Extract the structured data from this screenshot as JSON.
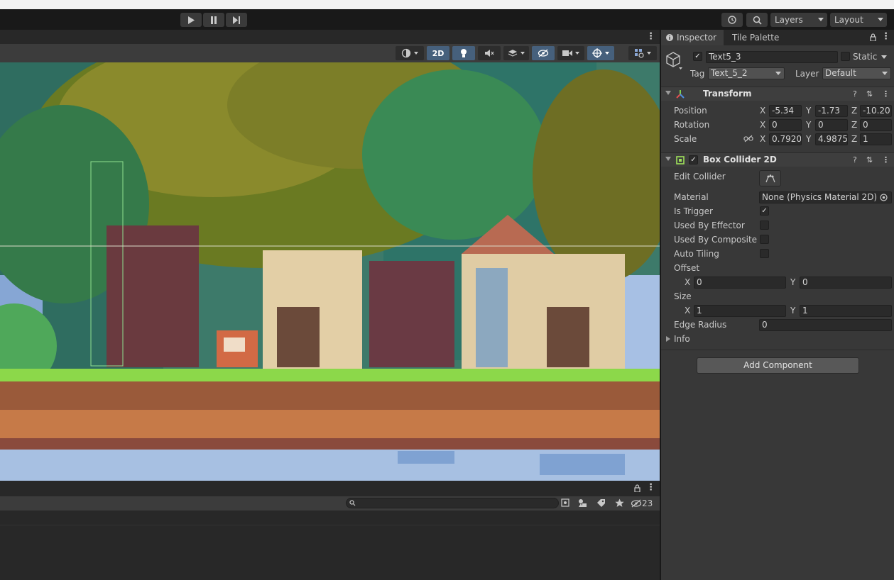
{
  "toolbar": {
    "play_icon": "play-icon",
    "pause_icon": "pause-icon",
    "step_icon": "step-icon",
    "history_icon": "history-icon",
    "search_icon": "search-icon",
    "layers_label": "Layers",
    "layout_label": "Layout"
  },
  "scene_toolbar": {
    "mode_2d_label": "2D"
  },
  "bottom_panel": {
    "hidden_count": "23"
  },
  "inspector": {
    "tabs": [
      "Inspector",
      "Tile Palette"
    ],
    "object": {
      "name": "Text5_3",
      "static_label": "Static",
      "tag_label": "Tag",
      "tag_value": "Text_5_2",
      "layer_label": "Layer",
      "layer_value": "Default"
    },
    "transform": {
      "title": "Transform",
      "position": {
        "label": "Position",
        "x": "-5.34",
        "y": "-1.73",
        "z": "-10.20"
      },
      "rotation": {
        "label": "Rotation",
        "x": "0",
        "y": "0",
        "z": "0"
      },
      "scale": {
        "label": "Scale",
        "x": "0.7920",
        "y": "4.9875",
        "z": "1"
      },
      "axis_x": "X",
      "axis_y": "Y",
      "axis_z": "Z"
    },
    "box_collider": {
      "title": "Box Collider 2D",
      "edit_collider_label": "Edit Collider",
      "material_label": "Material",
      "material_value": "None (Physics Material 2D)",
      "is_trigger_label": "Is Trigger",
      "used_by_effector_label": "Used By Effector",
      "used_by_composite_label": "Used By Composite",
      "auto_tiling_label": "Auto Tiling",
      "offset_label": "Offset",
      "offset_x": "0",
      "offset_y": "0",
      "size_label": "Size",
      "size_x": "1",
      "size_y": "1",
      "edge_radius_label": "Edge Radius",
      "edge_radius_value": "0",
      "info_label": "Info"
    },
    "add_component_label": "Add Component"
  }
}
